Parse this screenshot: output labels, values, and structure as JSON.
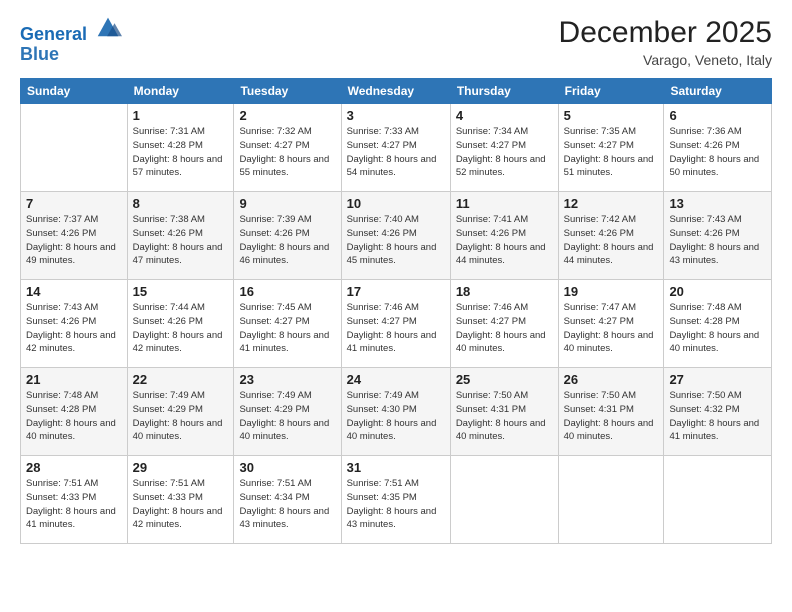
{
  "header": {
    "logo_line1": "General",
    "logo_line2": "Blue",
    "month": "December 2025",
    "location": "Varago, Veneto, Italy"
  },
  "days_of_week": [
    "Sunday",
    "Monday",
    "Tuesday",
    "Wednesday",
    "Thursday",
    "Friday",
    "Saturday"
  ],
  "weeks": [
    [
      {
        "day": "",
        "sunrise": "",
        "sunset": "",
        "daylight": ""
      },
      {
        "day": "1",
        "sunrise": "Sunrise: 7:31 AM",
        "sunset": "Sunset: 4:28 PM",
        "daylight": "Daylight: 8 hours and 57 minutes."
      },
      {
        "day": "2",
        "sunrise": "Sunrise: 7:32 AM",
        "sunset": "Sunset: 4:27 PM",
        "daylight": "Daylight: 8 hours and 55 minutes."
      },
      {
        "day": "3",
        "sunrise": "Sunrise: 7:33 AM",
        "sunset": "Sunset: 4:27 PM",
        "daylight": "Daylight: 8 hours and 54 minutes."
      },
      {
        "day": "4",
        "sunrise": "Sunrise: 7:34 AM",
        "sunset": "Sunset: 4:27 PM",
        "daylight": "Daylight: 8 hours and 52 minutes."
      },
      {
        "day": "5",
        "sunrise": "Sunrise: 7:35 AM",
        "sunset": "Sunset: 4:27 PM",
        "daylight": "Daylight: 8 hours and 51 minutes."
      },
      {
        "day": "6",
        "sunrise": "Sunrise: 7:36 AM",
        "sunset": "Sunset: 4:26 PM",
        "daylight": "Daylight: 8 hours and 50 minutes."
      }
    ],
    [
      {
        "day": "7",
        "sunrise": "Sunrise: 7:37 AM",
        "sunset": "Sunset: 4:26 PM",
        "daylight": "Daylight: 8 hours and 49 minutes."
      },
      {
        "day": "8",
        "sunrise": "Sunrise: 7:38 AM",
        "sunset": "Sunset: 4:26 PM",
        "daylight": "Daylight: 8 hours and 47 minutes."
      },
      {
        "day": "9",
        "sunrise": "Sunrise: 7:39 AM",
        "sunset": "Sunset: 4:26 PM",
        "daylight": "Daylight: 8 hours and 46 minutes."
      },
      {
        "day": "10",
        "sunrise": "Sunrise: 7:40 AM",
        "sunset": "Sunset: 4:26 PM",
        "daylight": "Daylight: 8 hours and 45 minutes."
      },
      {
        "day": "11",
        "sunrise": "Sunrise: 7:41 AM",
        "sunset": "Sunset: 4:26 PM",
        "daylight": "Daylight: 8 hours and 44 minutes."
      },
      {
        "day": "12",
        "sunrise": "Sunrise: 7:42 AM",
        "sunset": "Sunset: 4:26 PM",
        "daylight": "Daylight: 8 hours and 44 minutes."
      },
      {
        "day": "13",
        "sunrise": "Sunrise: 7:43 AM",
        "sunset": "Sunset: 4:26 PM",
        "daylight": "Daylight: 8 hours and 43 minutes."
      }
    ],
    [
      {
        "day": "14",
        "sunrise": "Sunrise: 7:43 AM",
        "sunset": "Sunset: 4:26 PM",
        "daylight": "Daylight: 8 hours and 42 minutes."
      },
      {
        "day": "15",
        "sunrise": "Sunrise: 7:44 AM",
        "sunset": "Sunset: 4:26 PM",
        "daylight": "Daylight: 8 hours and 42 minutes."
      },
      {
        "day": "16",
        "sunrise": "Sunrise: 7:45 AM",
        "sunset": "Sunset: 4:27 PM",
        "daylight": "Daylight: 8 hours and 41 minutes."
      },
      {
        "day": "17",
        "sunrise": "Sunrise: 7:46 AM",
        "sunset": "Sunset: 4:27 PM",
        "daylight": "Daylight: 8 hours and 41 minutes."
      },
      {
        "day": "18",
        "sunrise": "Sunrise: 7:46 AM",
        "sunset": "Sunset: 4:27 PM",
        "daylight": "Daylight: 8 hours and 40 minutes."
      },
      {
        "day": "19",
        "sunrise": "Sunrise: 7:47 AM",
        "sunset": "Sunset: 4:27 PM",
        "daylight": "Daylight: 8 hours and 40 minutes."
      },
      {
        "day": "20",
        "sunrise": "Sunrise: 7:48 AM",
        "sunset": "Sunset: 4:28 PM",
        "daylight": "Daylight: 8 hours and 40 minutes."
      }
    ],
    [
      {
        "day": "21",
        "sunrise": "Sunrise: 7:48 AM",
        "sunset": "Sunset: 4:28 PM",
        "daylight": "Daylight: 8 hours and 40 minutes."
      },
      {
        "day": "22",
        "sunrise": "Sunrise: 7:49 AM",
        "sunset": "Sunset: 4:29 PM",
        "daylight": "Daylight: 8 hours and 40 minutes."
      },
      {
        "day": "23",
        "sunrise": "Sunrise: 7:49 AM",
        "sunset": "Sunset: 4:29 PM",
        "daylight": "Daylight: 8 hours and 40 minutes."
      },
      {
        "day": "24",
        "sunrise": "Sunrise: 7:49 AM",
        "sunset": "Sunset: 4:30 PM",
        "daylight": "Daylight: 8 hours and 40 minutes."
      },
      {
        "day": "25",
        "sunrise": "Sunrise: 7:50 AM",
        "sunset": "Sunset: 4:31 PM",
        "daylight": "Daylight: 8 hours and 40 minutes."
      },
      {
        "day": "26",
        "sunrise": "Sunrise: 7:50 AM",
        "sunset": "Sunset: 4:31 PM",
        "daylight": "Daylight: 8 hours and 40 minutes."
      },
      {
        "day": "27",
        "sunrise": "Sunrise: 7:50 AM",
        "sunset": "Sunset: 4:32 PM",
        "daylight": "Daylight: 8 hours and 41 minutes."
      }
    ],
    [
      {
        "day": "28",
        "sunrise": "Sunrise: 7:51 AM",
        "sunset": "Sunset: 4:33 PM",
        "daylight": "Daylight: 8 hours and 41 minutes."
      },
      {
        "day": "29",
        "sunrise": "Sunrise: 7:51 AM",
        "sunset": "Sunset: 4:33 PM",
        "daylight": "Daylight: 8 hours and 42 minutes."
      },
      {
        "day": "30",
        "sunrise": "Sunrise: 7:51 AM",
        "sunset": "Sunset: 4:34 PM",
        "daylight": "Daylight: 8 hours and 43 minutes."
      },
      {
        "day": "31",
        "sunrise": "Sunrise: 7:51 AM",
        "sunset": "Sunset: 4:35 PM",
        "daylight": "Daylight: 8 hours and 43 minutes."
      },
      {
        "day": "",
        "sunrise": "",
        "sunset": "",
        "daylight": ""
      },
      {
        "day": "",
        "sunrise": "",
        "sunset": "",
        "daylight": ""
      },
      {
        "day": "",
        "sunrise": "",
        "sunset": "",
        "daylight": ""
      }
    ]
  ]
}
